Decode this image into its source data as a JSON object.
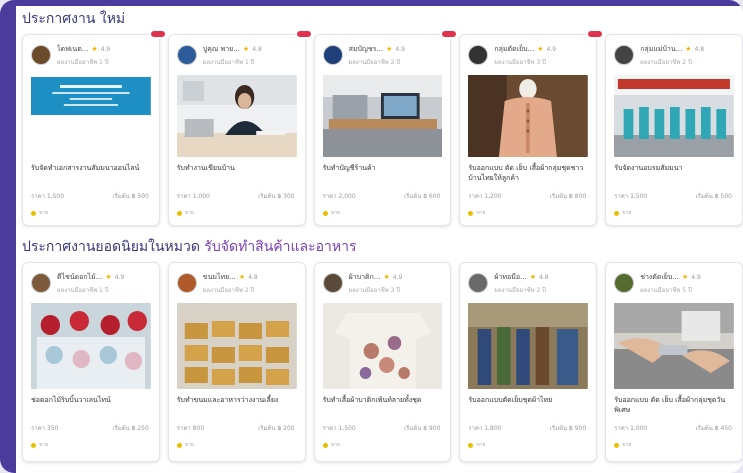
{
  "sections": [
    {
      "title": "ประกาศงาน ใหม่",
      "title_accent": "",
      "cards": [
        {
          "seller": "ไดฟเนต...",
          "rating": "4.9",
          "sub": "ผลงานมืออาชีพ 1 ปี",
          "title": "รับจัดทำเอกสารงานสัมมนาออนไลน์",
          "price": "ราคา 1,500",
          "delivery": "เริ่มต้น ฿ 500",
          "foot": "ขาย",
          "has_badge": true,
          "avatar_color": "#6b4b2a",
          "photo": "banner"
        },
        {
          "seller": "ปูคุณ พาย...",
          "rating": "4.8",
          "sub": "ผลงานมืออาชีพ 1 ปี",
          "title": "รับทำงานเขียนบ้าน",
          "price": "ราคา 1,000",
          "delivery": "เริ่มต้น ฿ 300",
          "foot": "ขาย",
          "has_badge": true,
          "avatar_color": "#2e5b9a",
          "photo": "office"
        },
        {
          "seller": "สมบัญชร...",
          "rating": "4.9",
          "sub": "ผลงานมืออาชีพ 2 ปี",
          "title": "รับทำบัญชีร้านค้า",
          "price": "ราคา 2,000",
          "delivery": "เริ่มต้น ฿ 600",
          "foot": "ขาย",
          "has_badge": true,
          "avatar_color": "#1f3f7a",
          "photo": "workspace"
        },
        {
          "seller": "กลุ่มตัดเย็บ...",
          "rating": "4.9",
          "sub": "ผลงานมืออาชีพ 3 ปี",
          "title": "รับออกแบบ ตัด เย็บ เสื้อผ้ากลุ่มชุดชาวบ้านไทยให้ลูกค้า",
          "price": "ราคา 1,200",
          "delivery": "เริ่มต้น ฿ 800",
          "foot": "ขาย",
          "has_badge": true,
          "avatar_color": "#333333",
          "photo": "shirt"
        },
        {
          "seller": "กลุ่มแม่บ้าน...",
          "rating": "4.8",
          "sub": "ผลงานมืออาชีพ 2 ปี",
          "title": "รับจัดงานอบรมสัมมนา",
          "price": "ราคา 1,500",
          "delivery": "เริ่มต้น ฿ 500",
          "foot": "ขาย",
          "has_badge": false,
          "avatar_color": "#444444",
          "photo": "hall"
        }
      ]
    },
    {
      "title": "ประกาศงานยอดนิยมในหมวด ",
      "title_accent": "รับจัดทำสินค้าและอาหาร",
      "cards": [
        {
          "seller": "ดีไซน์ดอกไม้...",
          "rating": "4.9",
          "sub": "ผลงานมืออาชีพ 1 ปี",
          "title": "ช่อดอกไม้ริบบิ้นวาเลนไทน์",
          "price": "ราคา 350",
          "delivery": "เริ่มต้น ฿ 250",
          "foot": "ขาย",
          "has_badge": false,
          "avatar_color": "#7a5a3a",
          "photo": "flowers"
        },
        {
          "seller": "ขนมไทย...",
          "rating": "4.8",
          "sub": "ผลงานมืออาชีพ 2 ปี",
          "title": "รับทำขนมและอาหารว่างงานเลี้ยง",
          "price": "ราคา 800",
          "delivery": "เริ่มต้น ฿ 200",
          "foot": "ขาย",
          "has_badge": false,
          "avatar_color": "#b05a2a",
          "photo": "snacks"
        },
        {
          "seller": "ผ้าบาติก...",
          "rating": "4.9",
          "sub": "ผลงานมืออาชีพ 3 ปี",
          "title": "รับทำเสื้อผ้าบาติกเพ้นท์ลายทั้งชุด",
          "price": "ราคา 1,500",
          "delivery": "เริ่มต้น ฿ 900",
          "foot": "ขาย",
          "has_badge": false,
          "avatar_color": "#5a4a3a",
          "photo": "batik"
        },
        {
          "seller": "ผ้าทอมือ...",
          "rating": "4.8",
          "sub": "ผลงานมืออาชีพ 2 ปี",
          "title": "รับออกแบบตัดเย็บชุดผ้าไทย",
          "price": "ราคา 1,800",
          "delivery": "เริ่มต้น ฿ 900",
          "foot": "ขาย",
          "has_badge": false,
          "avatar_color": "#6a6a6a",
          "photo": "people"
        },
        {
          "seller": "ช่างตัดเย็บ...",
          "rating": "4.9",
          "sub": "ผลงานมืออาชีพ 5 ปี",
          "title": "รับออกแบบ ตัด เย็บ เสื้อผ้ากลุ่มชุดวันพิเศษ",
          "price": "ราคา 1,000",
          "delivery": "เริ่มต้น ฿ 450",
          "foot": "ขาย",
          "has_badge": false,
          "avatar_color": "#556b2f",
          "photo": "sewing"
        }
      ]
    }
  ]
}
